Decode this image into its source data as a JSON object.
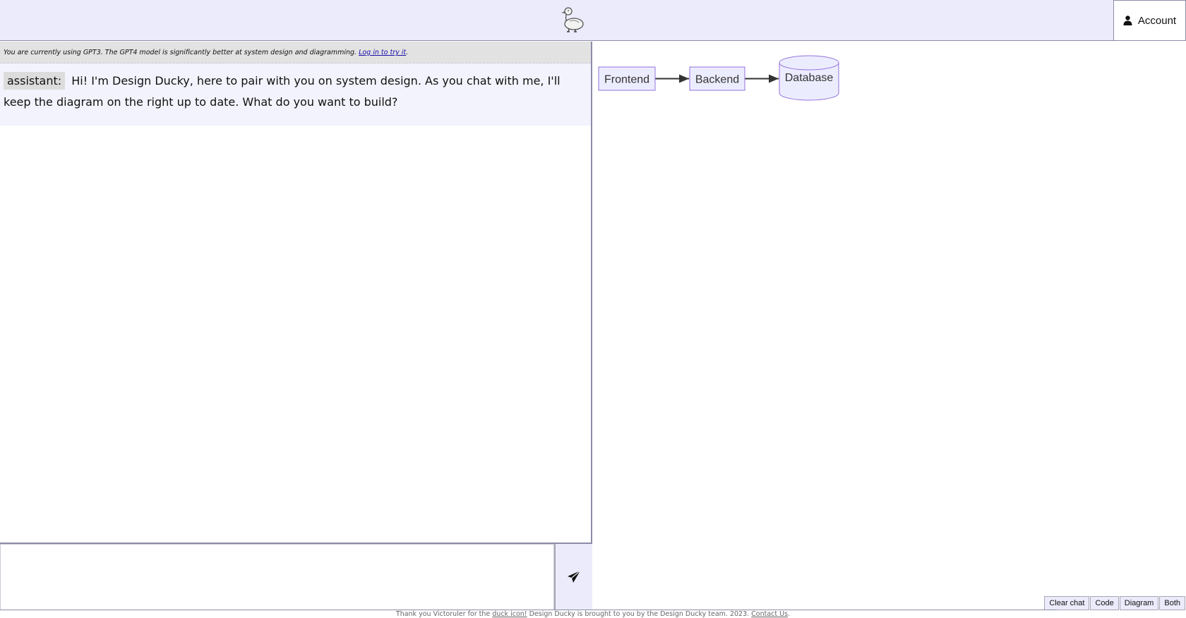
{
  "header": {
    "logo_alt": "duck-logo",
    "account_label": "Account"
  },
  "chat": {
    "notice_text": "You are currently using GPT3. The GPT4 model is significantly better at system design and diagramming. ",
    "notice_link": "Log in to try it",
    "notice_suffix": ".",
    "messages": [
      {
        "role": "assistant:",
        "text": "Hi! I'm Design Ducky, here to pair with you on system design. As you chat with me, I'll keep the diagram on the right up to date. What do you want to build?"
      }
    ],
    "input_value": "",
    "input_placeholder": ""
  },
  "diagram": {
    "nodes": [
      {
        "id": "frontend",
        "label": "Frontend",
        "shape": "rect"
      },
      {
        "id": "backend",
        "label": "Backend",
        "shape": "rect"
      },
      {
        "id": "database",
        "label": "Database",
        "shape": "cylinder"
      }
    ],
    "edges": [
      {
        "from": "frontend",
        "to": "backend"
      },
      {
        "from": "backend",
        "to": "database"
      }
    ],
    "colors": {
      "node_fill": "#ececff",
      "node_stroke": "#9370db",
      "edge": "#333333"
    }
  },
  "view_buttons": {
    "clear": "Clear chat",
    "code": "Code",
    "diagram": "Diagram",
    "both": "Both"
  },
  "footer": {
    "prefix": "Thank you Victoruler for the ",
    "duck_link": "duck icon!",
    "middle": " Design Ducky is brought to you by the Design Ducky team. 2023. ",
    "contact_link": "Contact Us",
    "suffix": "."
  }
}
